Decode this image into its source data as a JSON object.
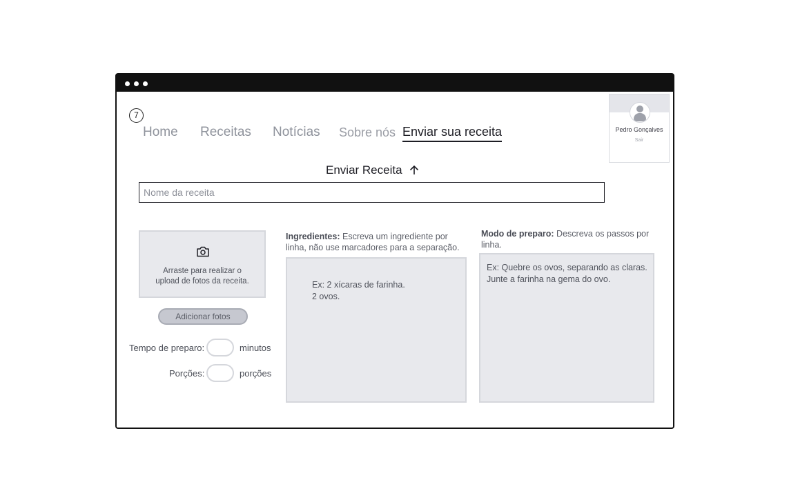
{
  "nav": {
    "step": "7",
    "items": [
      {
        "label": "Home"
      },
      {
        "label": "Receitas"
      },
      {
        "label": "Notícias"
      },
      {
        "label": "Sobre nós"
      },
      {
        "label": "Enviar sua receita",
        "active": true
      }
    ]
  },
  "profile": {
    "name": "Pedro Gonçalves",
    "logout": "Sair",
    "icon": "user-avatar-icon"
  },
  "form": {
    "heading": "Enviar Receita",
    "heading_icon": "arrow-up-icon",
    "name_placeholder": "Nome da receita",
    "upload": {
      "icon": "camera-icon",
      "text": "Arraste para realizar o\nupload de fotos da receita.",
      "button": "Adicionar fotos"
    },
    "prep_time": {
      "label": "Tempo de preparo:",
      "unit": "minutos",
      "value": ""
    },
    "servings": {
      "label": "Porções:",
      "unit": "porções",
      "value": ""
    },
    "ingredients": {
      "title": "Ingredientes:",
      "description": "Escreva um ingrediente por linha, não use marcadores para a separação.",
      "example": "Ex: 2 xícaras de farinha.\n2 ovos."
    },
    "method": {
      "title": "Modo de preparo:",
      "description": "Descreva os passos por linha.",
      "example": "Ex: Quebre os ovos, separando as claras.\nJunte a farinha na gema do ovo."
    }
  },
  "colors": {
    "window_frame": "#111111",
    "panel_bg": "#e8e9ed",
    "panel_border": "#d5d7dc",
    "nav_inactive": "#8f939c",
    "nav_active": "#1d1d24",
    "button_bg": "#c6c8d0"
  }
}
